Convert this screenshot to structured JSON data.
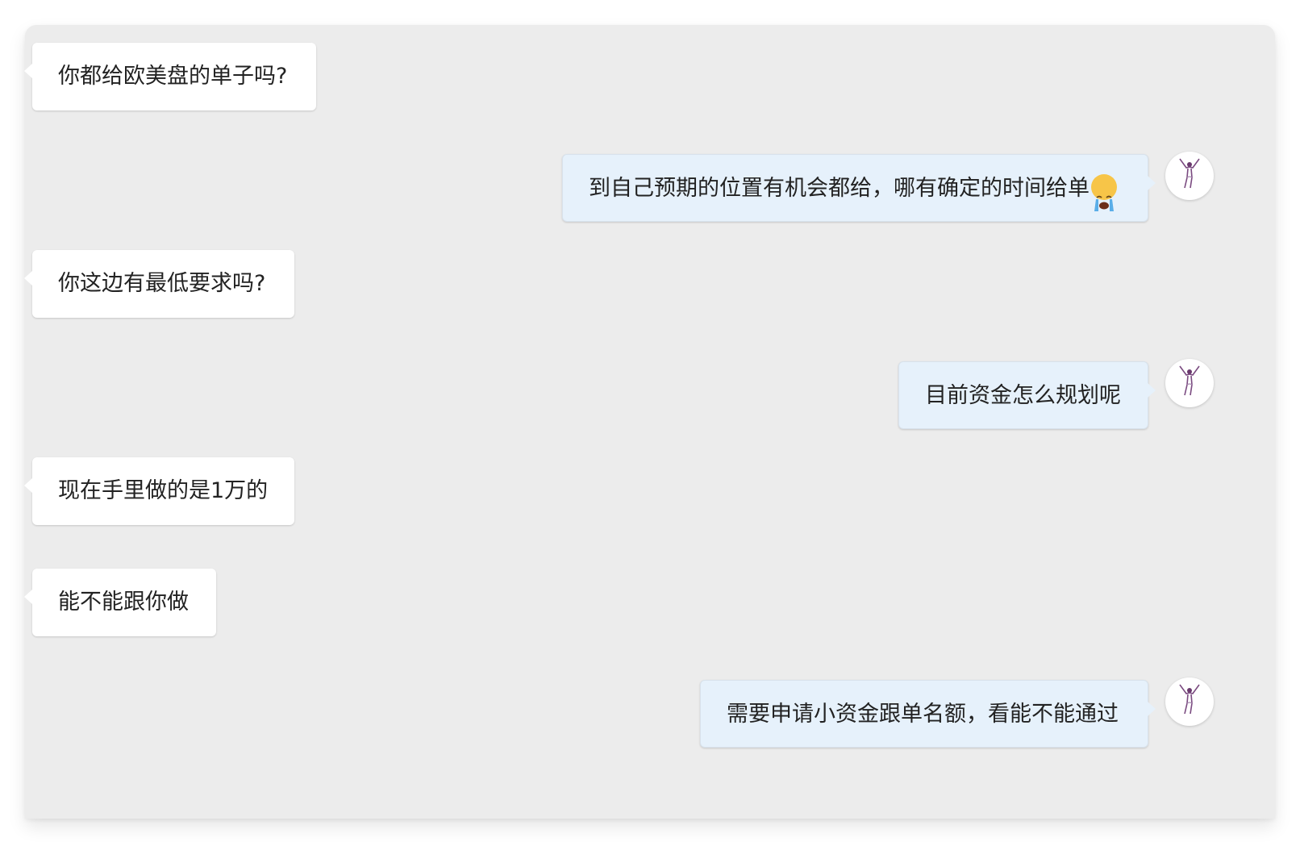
{
  "messages": [
    {
      "side": "in",
      "text": "你都给欧美盘的单子吗?"
    },
    {
      "side": "out",
      "text": "到自己预期的位置有机会都给，哪有确定的时间给单",
      "emoji": "loudly-crying-face-icon"
    },
    {
      "side": "in",
      "text": "你这边有最低要求吗?"
    },
    {
      "side": "out",
      "text": "目前资金怎么规划呢"
    },
    {
      "side": "in",
      "text": "现在手里做的是1万的"
    },
    {
      "side": "in",
      "text": "能不能跟你做"
    },
    {
      "side": "out",
      "text": "需要申请小资金跟单名额，看能不能通过"
    }
  ],
  "colors": {
    "panel_background": "#ececec",
    "incoming_bubble": "#ffffff",
    "outgoing_bubble": "#e6f1fb",
    "text": "#222222"
  },
  "avatar_icon": "dancer-figure-icon"
}
